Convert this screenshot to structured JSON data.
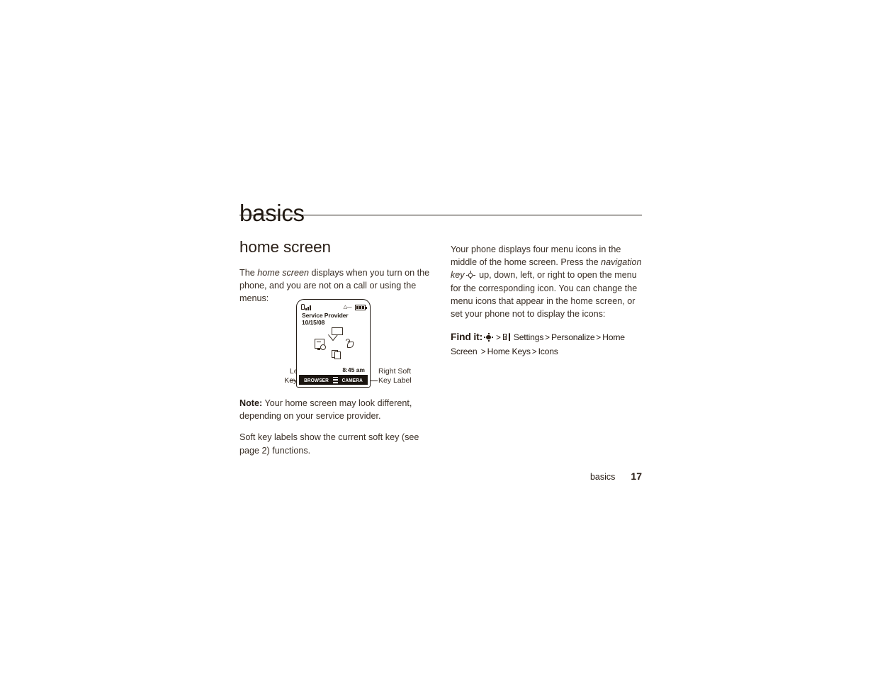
{
  "page": {
    "chapter_title": "basics",
    "footer_section": "basics",
    "footer_page_number": "17"
  },
  "left_column": {
    "section_title": "home screen",
    "intro_part1": "The ",
    "intro_emphasis": "home screen",
    "intro_part2": " displays when you turn on the phone, and you are not on a call or using the menus:",
    "note_label": "Note:",
    "note_text": " Your home screen may look different, depending on your service provider.",
    "softkey_note": "Soft key labels show the current soft key (see page 2) functions."
  },
  "phone_illustration": {
    "status_bar": {
      "signal_icon": "signal-bars-icon",
      "ringer_icon": "ringer-alert-icon",
      "battery_icon": "battery-icon"
    },
    "service_provider": "Service Provider",
    "date": "10/15/08",
    "clock": "8:45 am",
    "menu_icons": [
      {
        "name": "messages-envelope-icon",
        "position": "top"
      },
      {
        "name": "calendar-clock-icon",
        "position": "left"
      },
      {
        "name": "alert-bell-icon",
        "position": "right"
      },
      {
        "name": "documents-pages-icon",
        "position": "bottom"
      }
    ],
    "soft_keys": {
      "left_label": "BROWSER",
      "center_icon": "menu-grid-icon",
      "right_label": "CAMERA"
    },
    "callouts": {
      "left": "Left Soft\nKey Label",
      "left_line1": "Left Soft",
      "left_line2": "Key Label",
      "right_line1": "Right Soft",
      "right_line2": "Key Label"
    }
  },
  "right_column": {
    "paragraph_part1": "Your phone displays four menu icons in the middle of the home screen. Press the ",
    "paragraph_emphasis": "navigation key",
    "paragraph_part2": " up, down, left, or right to open the menu for the corresponding icon. You can change the menu icons that appear in the home screen, or set your phone not to display the icons:",
    "find_it_label": "Find it:",
    "find_it_path": [
      {
        "type": "icon",
        "name": "navigation-key-icon"
      },
      {
        "type": "sep",
        "text": ">"
      },
      {
        "type": "icon",
        "name": "settings-tools-icon"
      },
      {
        "type": "item",
        "text": "Settings"
      },
      {
        "type": "sep",
        "text": ">"
      },
      {
        "type": "item",
        "text": "Personalize"
      },
      {
        "type": "sep",
        "text": ">"
      },
      {
        "type": "item",
        "text": "Home Screen"
      },
      {
        "type": "sep",
        "text": ">"
      },
      {
        "type": "item",
        "text": "Home Keys"
      },
      {
        "type": "sep",
        "text": ">"
      },
      {
        "type": "item",
        "text": "Icons"
      }
    ],
    "find_it_line1_items": {
      "settings": "Settings",
      "personalize": "Personalize",
      "home_screen": "Home Screen"
    },
    "find_it_line2_items": {
      "home_keys": "Home Keys",
      "icons": "Icons"
    },
    "separator": ">"
  },
  "colors": {
    "text": "#2b2018",
    "body_text": "#3a2f26",
    "rule": "#211a13",
    "softbar_bg": "#1b1510",
    "page_bg": "#ffffff"
  }
}
